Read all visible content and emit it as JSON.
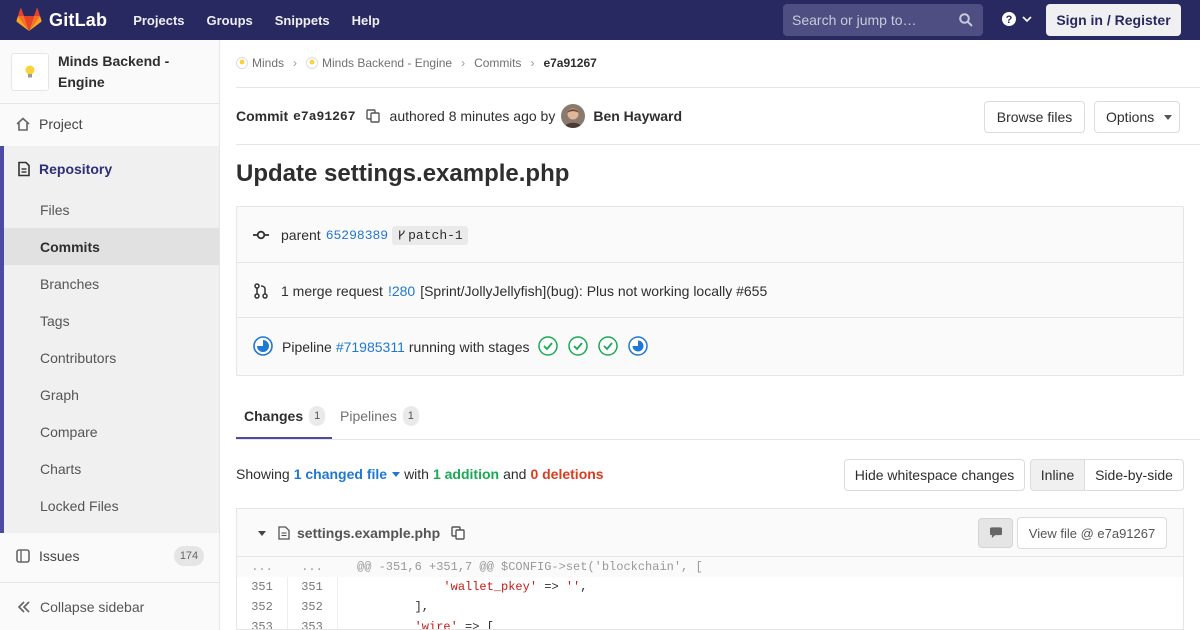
{
  "brand": {
    "name": "GitLab"
  },
  "nav": {
    "links": [
      "Projects",
      "Groups",
      "Snippets",
      "Help"
    ],
    "search_placeholder": "Search or jump to…",
    "sign_in": "Sign in / Register"
  },
  "sidebar": {
    "project_name": "Minds Backend - Engine",
    "project_item": "Project",
    "repository": "Repository",
    "repo_items": [
      "Files",
      "Commits",
      "Branches",
      "Tags",
      "Contributors",
      "Graph",
      "Compare",
      "Charts",
      "Locked Files"
    ],
    "active_item": "Commits",
    "issues": "Issues",
    "issues_count": "174",
    "collapse": "Collapse sidebar"
  },
  "breadcrumb": {
    "items": [
      "Minds",
      "Minds Backend - Engine",
      "Commits"
    ],
    "current": "e7a91267"
  },
  "commit": {
    "label": "Commit",
    "sha": "e7a91267",
    "authored": "authored 8 minutes ago by",
    "author": "Ben Hayward",
    "browse_files": "Browse files",
    "options": "Options",
    "title": "Update settings.example.php"
  },
  "info": {
    "parent_label": "parent",
    "parent_sha": "65298389",
    "parent_branch": "patch-1",
    "mr_label": "1 merge request",
    "mr_id": "!280",
    "mr_title": "[Sprint/JollyJellyfish](bug): Plus not working locally #655",
    "pipeline_label": "Pipeline",
    "pipeline_id": "#71985311",
    "pipeline_text": "running with stages",
    "stages": [
      "passed",
      "passed",
      "passed",
      "running"
    ]
  },
  "tabs": [
    {
      "label": "Changes",
      "count": "1",
      "active": true
    },
    {
      "label": "Pipelines",
      "count": "1",
      "active": false
    }
  ],
  "summary": {
    "showing": "Showing",
    "changed": "1 changed file",
    "with": "with",
    "additions": "1 addition",
    "and": "and",
    "deletions": "0 deletions",
    "hide_ws": "Hide whitespace changes",
    "inline": "Inline",
    "side_by_side": "Side-by-side"
  },
  "file": {
    "name": "settings.example.php",
    "view_file": "View file @ e7a91267"
  },
  "diff": {
    "hunk_old": "...",
    "hunk_new": "...",
    "hunk": "@@ -351,6 +351,7 @@ $CONFIG->set('blockchain', [",
    "lines": [
      {
        "old": "351",
        "new": "351",
        "pre": "            ",
        "str": "'wallet_pkey'",
        "mid": " => ",
        "str2": "''",
        "post": ","
      },
      {
        "old": "352",
        "new": "352",
        "pre": "        ],",
        "str": "",
        "mid": "",
        "str2": "",
        "post": ""
      },
      {
        "old": "353",
        "new": "353",
        "pre": "        ",
        "str": "'wire'",
        "mid": " => [",
        "str2": "",
        "post": ""
      }
    ]
  },
  "colors": {
    "navbar": "#292961",
    "accent": "#4b4ba3",
    "link": "#1f78d1",
    "success": "#1aaa55",
    "danger": "#db3b21"
  }
}
